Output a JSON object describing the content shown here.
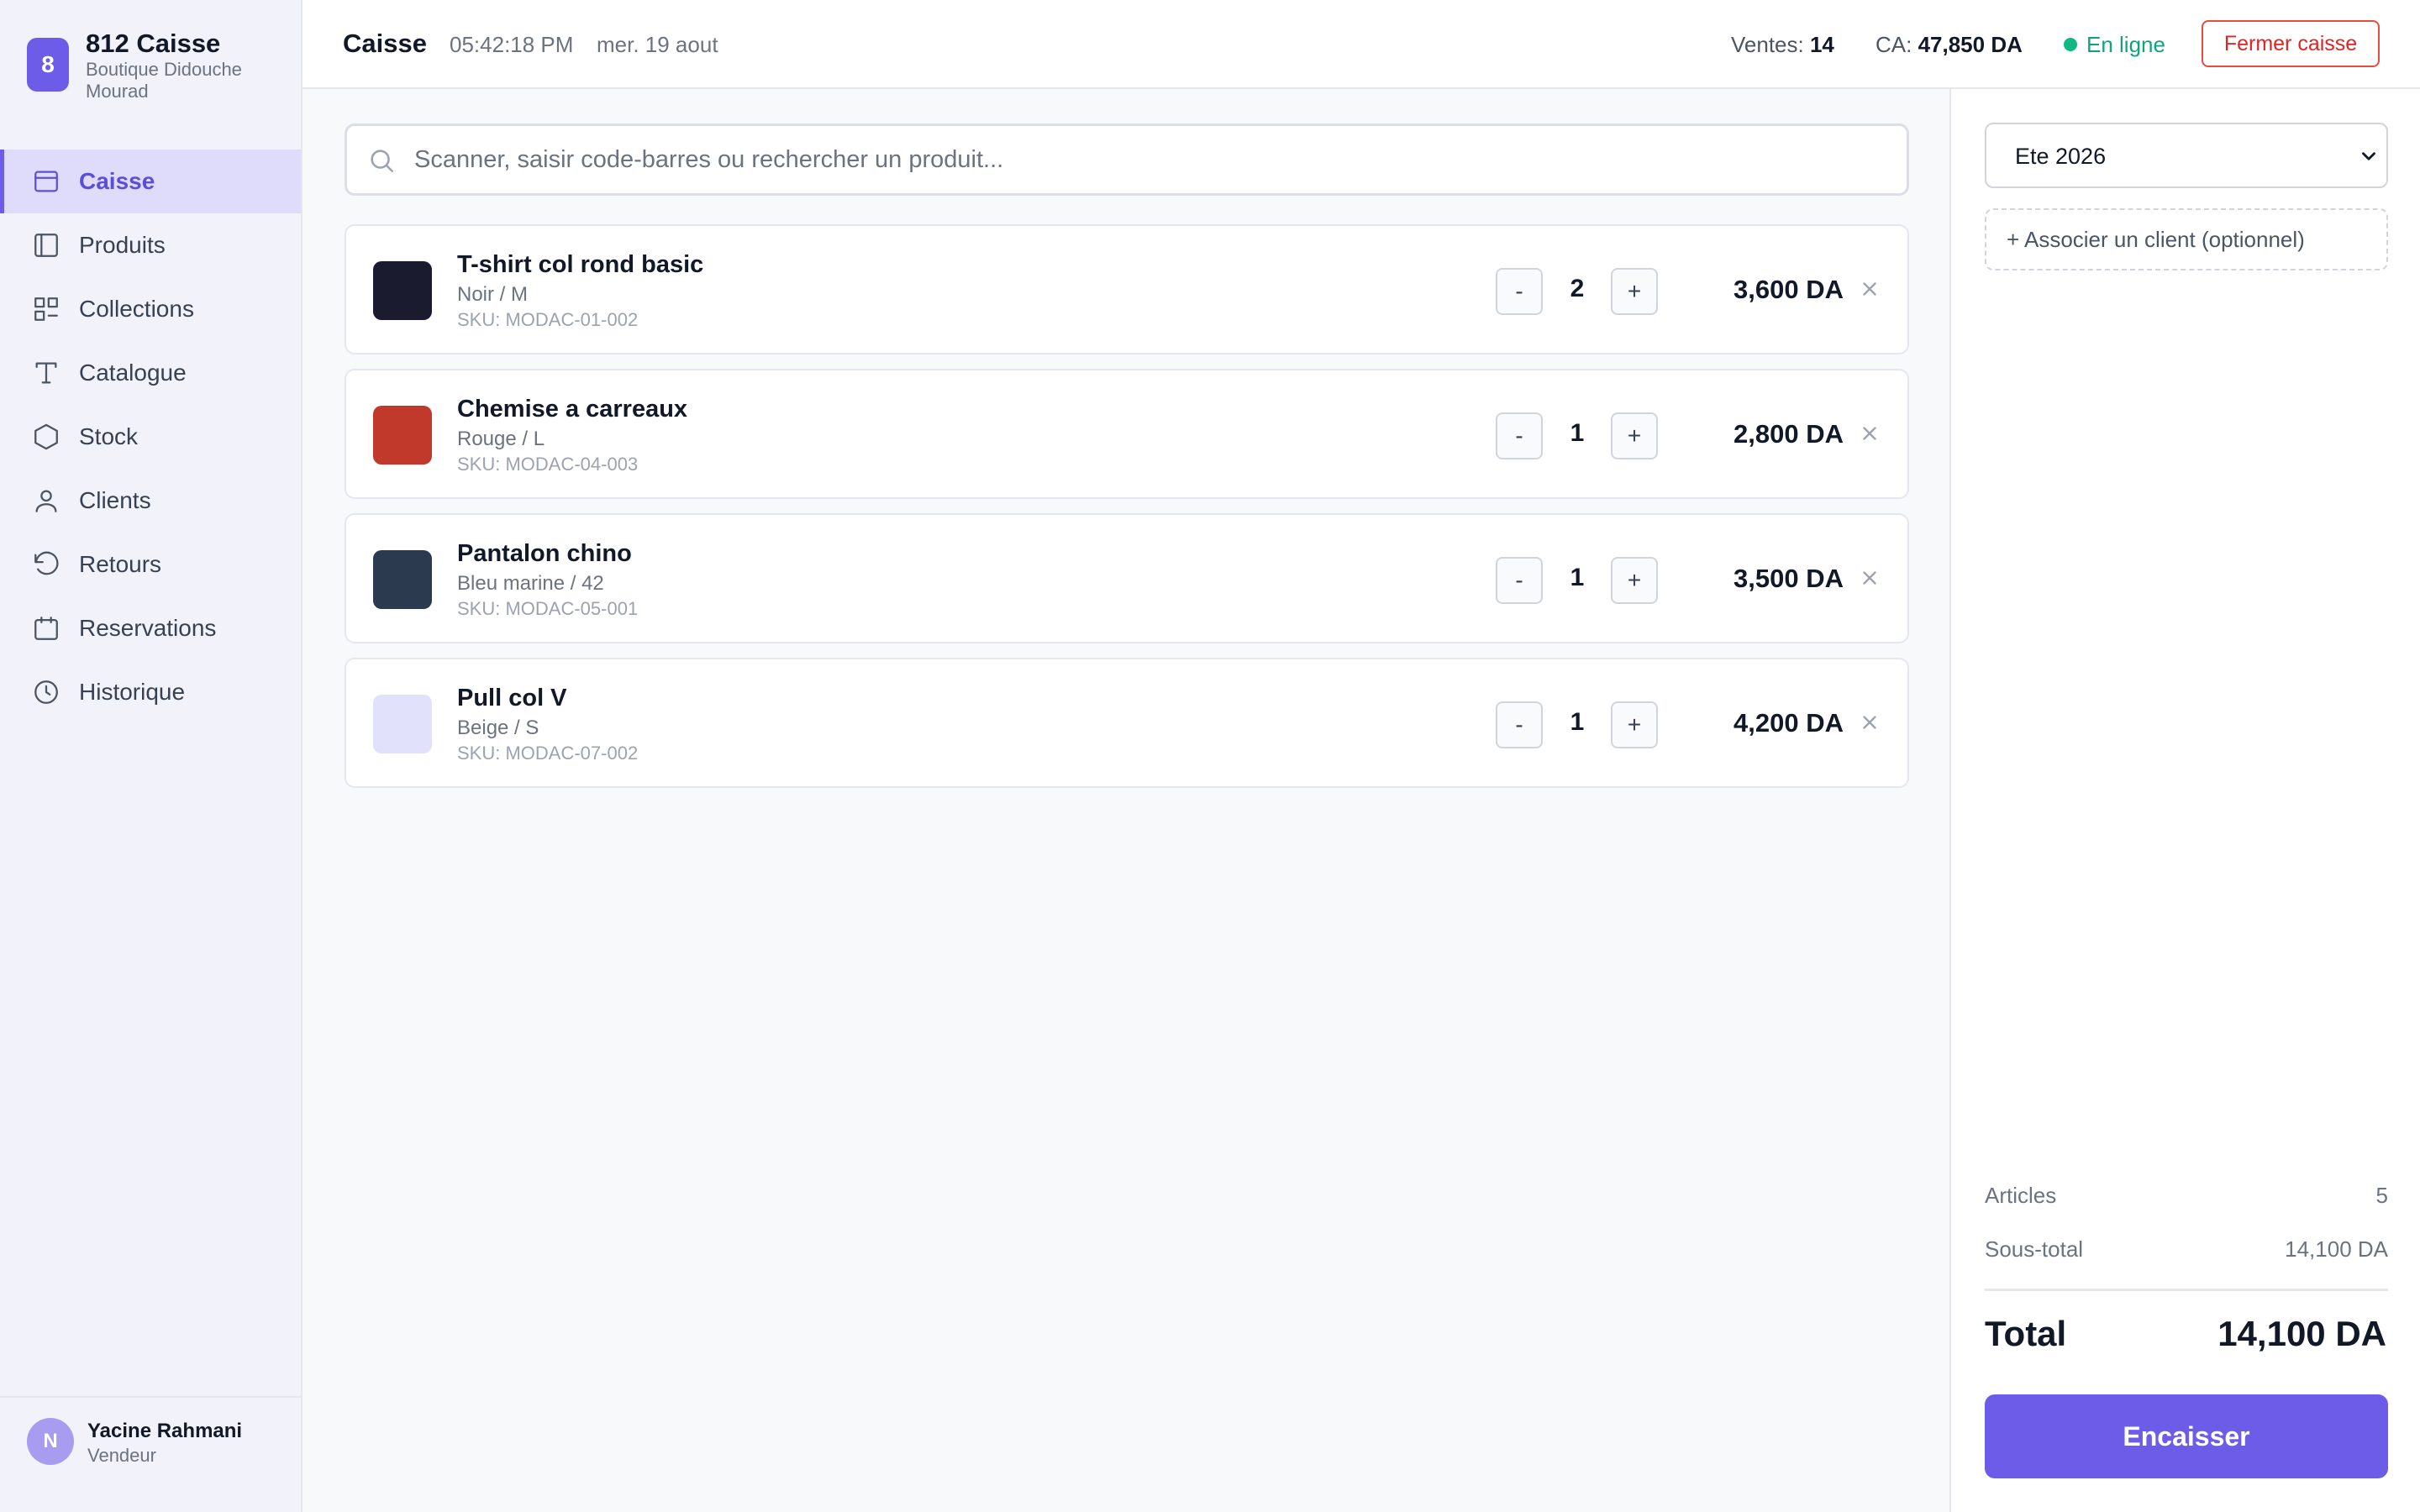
{
  "brand": {
    "logo_letter": "8",
    "name": "812 Caisse",
    "subtitle": "Boutique Didouche Mourad",
    "accent_color": "#6c5ce7"
  },
  "nav": {
    "items": [
      {
        "label": "Caisse",
        "icon": "register-icon",
        "active": true
      },
      {
        "label": "Produits",
        "icon": "products-icon",
        "active": false
      },
      {
        "label": "Collections",
        "icon": "collections-icon",
        "active": false
      },
      {
        "label": "Catalogue",
        "icon": "catalogue-icon",
        "active": false
      },
      {
        "label": "Stock",
        "icon": "stock-icon",
        "active": false
      },
      {
        "label": "Clients",
        "icon": "user-icon",
        "active": false
      },
      {
        "label": "Retours",
        "icon": "returns-icon",
        "active": false
      },
      {
        "label": "Reservations",
        "icon": "calendar-icon",
        "active": false
      },
      {
        "label": "Historique",
        "icon": "clock-icon",
        "active": false
      }
    ]
  },
  "user": {
    "initial": "N",
    "name": "Yacine Rahmani",
    "role": "Vendeur"
  },
  "topbar": {
    "title": "Caisse",
    "time": "05:42:18 PM",
    "date": "mer. 19 aout",
    "sales_label": "Ventes:",
    "sales_value": "14",
    "revenue_label": "CA:",
    "revenue_value": "47,850 DA",
    "status": "En ligne",
    "status_color": "#10b981",
    "close_button": "Fermer caisse"
  },
  "search": {
    "placeholder": "Scanner, saisir code-barres ou rechercher un produit...",
    "value": ""
  },
  "cart": {
    "items": [
      {
        "name": "T-shirt col rond basic",
        "variant": "Noir / M",
        "sku": "SKU: MODAC-01-002",
        "qty": "2",
        "price": "3,600 DA",
        "color": "#1a1b2e"
      },
      {
        "name": "Chemise a carreaux",
        "variant": "Rouge / L",
        "sku": "SKU: MODAC-04-003",
        "qty": "1",
        "price": "2,800 DA",
        "color": "#c0392b"
      },
      {
        "name": "Pantalon chino",
        "variant": "Bleu marine / 42",
        "sku": "SKU: MODAC-05-001",
        "qty": "1",
        "price": "3,500 DA",
        "color": "#2c3a4f"
      },
      {
        "name": "Pull col V",
        "variant": "Beige / S",
        "sku": "SKU: MODAC-07-002",
        "qty": "1",
        "price": "4,200 DA",
        "color": "#e2e1fb"
      }
    ]
  },
  "panel": {
    "collection_selected": "Ete 2026",
    "client_button": "+ Associer un client (optionnel)",
    "articles_label": "Articles",
    "articles_value": "5",
    "subtotal_label": "Sous-total",
    "subtotal_value": "14,100 DA",
    "total_label": "Total",
    "total_value": "14,100 DA",
    "pay_button": "Encaisser"
  }
}
